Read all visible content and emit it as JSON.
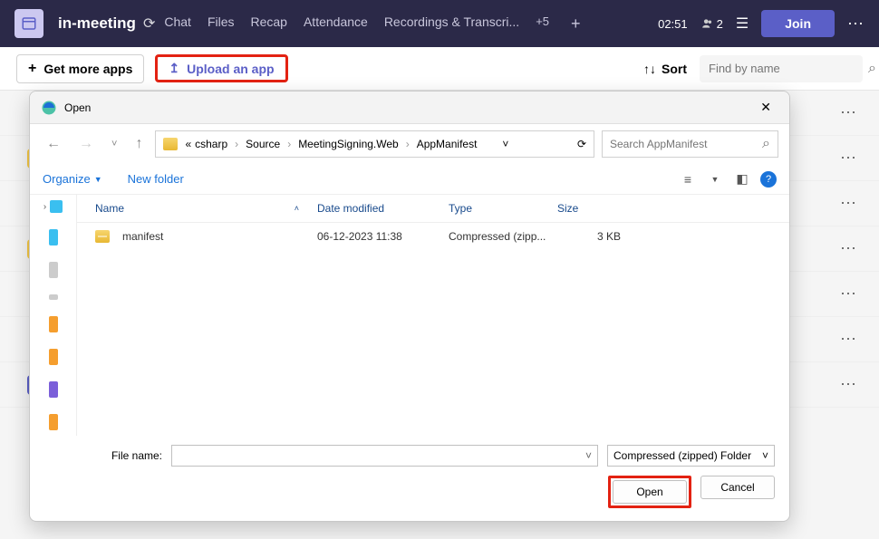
{
  "topbar": {
    "title": "in-meeting",
    "tabs": [
      "Chat",
      "Files",
      "Recap",
      "Attendance",
      "Recordings & Transcri..."
    ],
    "tab_more": "+5",
    "timer": "02:51",
    "participants_count": "2",
    "join_label": "Join"
  },
  "secondbar": {
    "get_apps": "Get more apps",
    "upload": "Upload an app",
    "sort": "Sort",
    "search_placeholder": "Find by name"
  },
  "dialog": {
    "title": "Open",
    "breadcrumb_prefix": "«",
    "breadcrumb": [
      "csharp",
      "Source",
      "MeetingSigning.Web",
      "AppManifest"
    ],
    "search_placeholder": "Search AppManifest",
    "organize": "Organize",
    "newfolder": "New folder",
    "columns": {
      "name": "Name",
      "date": "Date modified",
      "type": "Type",
      "size": "Size"
    },
    "files": [
      {
        "name": "manifest",
        "date": "06-12-2023 11:38",
        "type": "Compressed (zipp...",
        "size": "3 KB"
      }
    ],
    "filename_label": "File name:",
    "filetype": "Compressed (zipped) Folder",
    "open_btn": "Open",
    "cancel_btn": "Cancel"
  }
}
